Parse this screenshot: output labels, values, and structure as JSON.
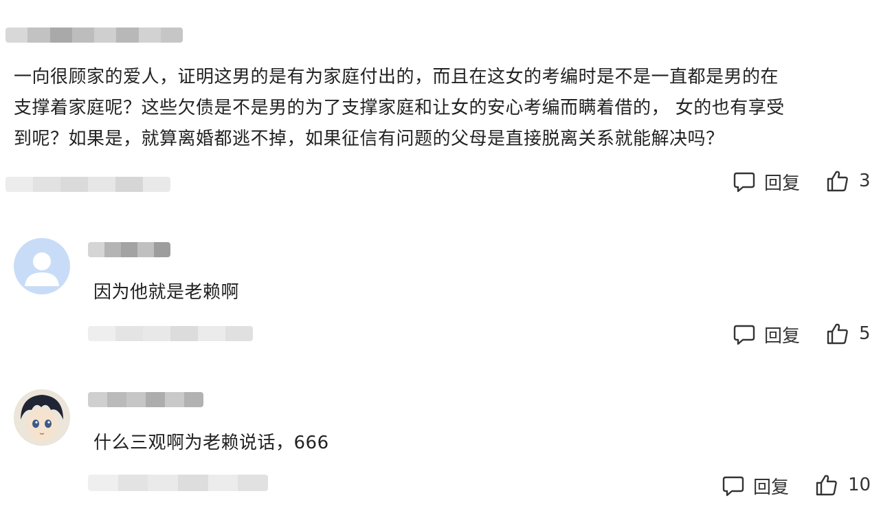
{
  "comments": [
    {
      "text_lines": [
        "一向很顾家的爱人，证明这男的是有为家庭付出的，而且在这女的考编时是不是一直都是男的在",
        "支撑着家庭呢？这些欠债是不是男的为了支撑家庭和让女的安心考编而瞒着借的， 女的也有享受",
        "到呢？如果是，就算离婚都逃不掉，如果征信有问题的父母是直接脱离关系就能解决吗？"
      ],
      "reply_label": "回复",
      "like_count": "3"
    },
    {
      "text": "因为他就是老赖啊",
      "reply_label": "回复",
      "like_count": "5"
    },
    {
      "text": "什么三观啊为老赖说话，666",
      "reply_label": "回复",
      "like_count": "10"
    }
  ],
  "icons": {
    "reply": "speech-bubble-icon",
    "like": "thumbs-up-icon"
  },
  "colors": {
    "text": "#222222",
    "action_text": "#333333",
    "default_avatar": "#c9dcf7"
  }
}
